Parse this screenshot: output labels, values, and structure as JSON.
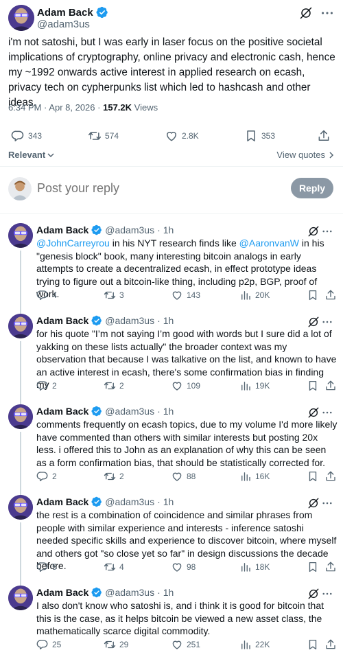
{
  "tweet": {
    "author_name": "Adam Back",
    "handle": "@adam3us",
    "text": "i'm not satoshi, but I was early in laser focus on the positive societal implications of cryptography, online privacy and electronic cash, hence my ~1992 onwards active interest in applied research on ecash, privacy tech on cypherpunks list which led to hashcash and other ideas.",
    "time": "6:34 PM",
    "separator": "·",
    "date": "Apr 8, 2026",
    "dot2": "·",
    "views_count": "157.2K",
    "views_label": "Views",
    "replies": "343",
    "retweets": "574",
    "likes": "2.8K",
    "bookmarks": "353",
    "icons": [
      "grok-icon",
      "more-icon",
      "verified-badge-icon",
      "reply-icon",
      "retweet-icon",
      "like-icon",
      "bookmark-icon",
      "share-icon"
    ]
  },
  "sort": {
    "label": "Relevant",
    "view_quotes": "View quotes"
  },
  "compose": {
    "placeholder": "Post your reply",
    "button": "Reply"
  },
  "colors": {
    "text": "#0f1419",
    "secondary": "#536471",
    "link": "#1d9bf0",
    "verified": "#1d9bf0",
    "reply_button_disabled": "#8b98a5",
    "divider": "#eff3f4"
  },
  "replies": [
    {
      "name": "Adam Back",
      "handle": "@adam3us",
      "dot": "·",
      "time": "1h",
      "mention1": "@JohnCarreyrou",
      "t1": " in his NYT research finds like ",
      "mention2": "@AaronvanW",
      "t2": " in his \"genesis block\" book, many interesting bitcoin analogs in early attempts to create a decentralized ecash, in effect prototype ideas trying to figure out a bitcoin-like thing, including p2p, BGP, proof of work.",
      "replies": "4",
      "retweets": "3",
      "likes": "143",
      "views": "20K"
    },
    {
      "name": "Adam Back",
      "handle": "@adam3us",
      "dot": "·",
      "time": "1h",
      "text": "for his quote \"I’m not saying I’m good with words but I sure did a lot of yakking on these lists actually\" the broader context was my observation that because I was talkative on the list, and known to have an active interest in ecash, there's some confirmation bias in finding my",
      "replies": "2",
      "retweets": "2",
      "likes": "109",
      "views": "19K"
    },
    {
      "name": "Adam Back",
      "handle": "@adam3us",
      "dot": "·",
      "time": "1h",
      "text": "comments frequently on ecash topics, due to my volume I'd more likely have commented than others with similar interests but posting 20x less. i offered this to John as an explanation of why this can be seen as a form confirmation bias, that should be statistically corrected for.",
      "replies": "2",
      "retweets": "2",
      "likes": "88",
      "views": "16K"
    },
    {
      "name": "Adam Back",
      "handle": "@adam3us",
      "dot": "·",
      "time": "1h",
      "text": "the rest is a combination of coincidence and similar phrases from people with similar experience and interests - inference satoshi needed specific skills and experience to discover bitcoin, where myself and others got \"so close yet so far\" in design discussions the decade before.",
      "replies": "5",
      "retweets": "4",
      "likes": "98",
      "views": "18K"
    },
    {
      "name": "Adam Back",
      "handle": "@adam3us",
      "dot": "·",
      "time": "1h",
      "text": "I also don't know who satoshi is, and i think it is good for bitcoin that this is the case, as it helps bitcoin be viewed a new asset class, the mathematically scarce digital commodity.",
      "replies": "25",
      "retweets": "29",
      "likes": "251",
      "views": "22K"
    }
  ]
}
